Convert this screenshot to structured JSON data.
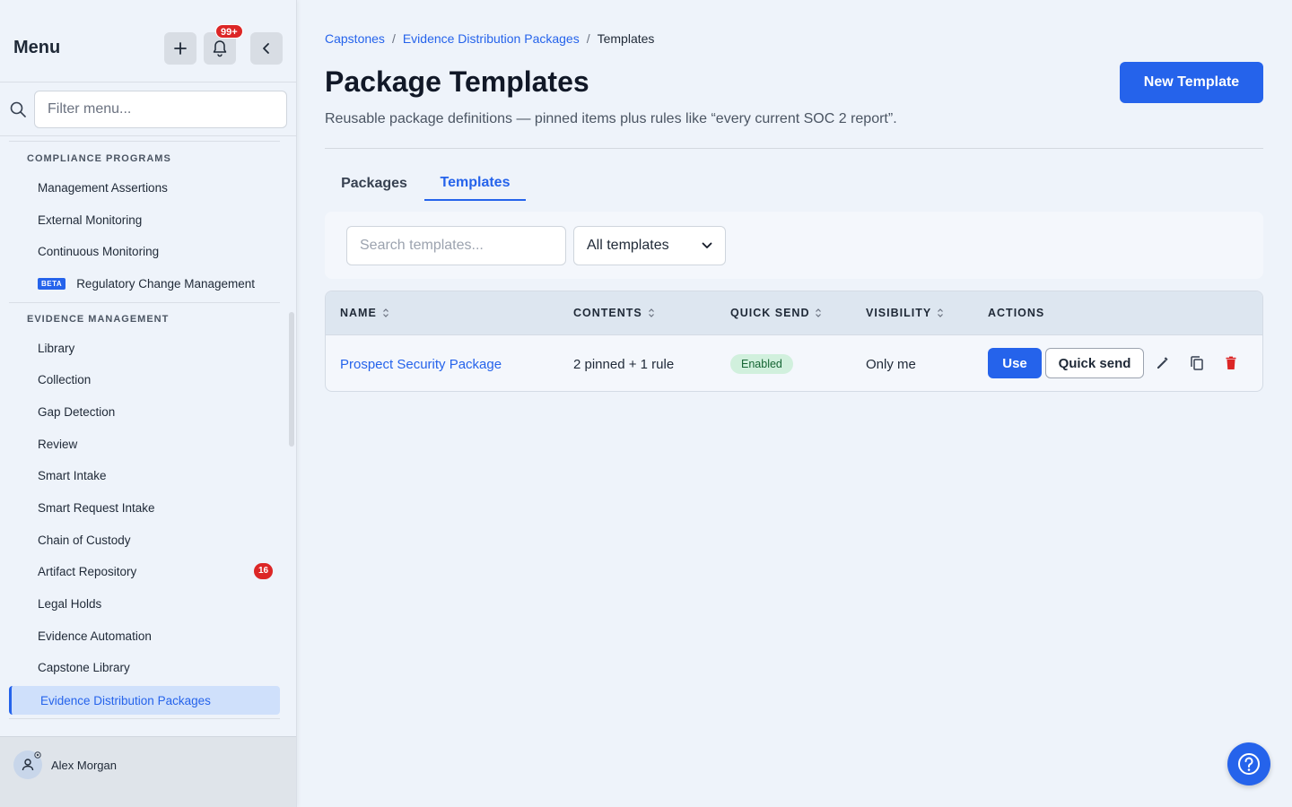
{
  "sidebar": {
    "title": "Menu",
    "bell_badge": "99+",
    "filter_placeholder": "Filter menu...",
    "sections": [
      {
        "heading": "COMPLIANCE PROGRAMS",
        "items": [
          {
            "label": "Management Assertions"
          },
          {
            "label": "External Monitoring"
          },
          {
            "label": "Continuous Monitoring"
          },
          {
            "label": "Regulatory Change Management",
            "badge": "BETA"
          }
        ]
      },
      {
        "heading": "EVIDENCE MANAGEMENT",
        "items": [
          {
            "label": "Library"
          },
          {
            "label": "Collection"
          },
          {
            "label": "Gap Detection"
          },
          {
            "label": "Review"
          },
          {
            "label": "Smart Intake"
          },
          {
            "label": "Smart Request Intake"
          },
          {
            "label": "Chain of Custody"
          },
          {
            "label": "Artifact Repository",
            "count": "16"
          },
          {
            "label": "Legal Holds"
          },
          {
            "label": "Evidence Automation"
          },
          {
            "label": "Capstone Library"
          },
          {
            "label": "Evidence Distribution Packages",
            "active": true
          }
        ]
      }
    ],
    "user": {
      "name": "Alex Morgan"
    }
  },
  "breadcrumb": {
    "items": [
      "Capstones",
      "Evidence Distribution Packages"
    ],
    "separator": "/",
    "current": "Templates"
  },
  "page": {
    "title": "Package Templates",
    "subtitle": "Reusable package definitions — pinned items plus rules like “every current SOC 2 report”.",
    "new_button": "New Template"
  },
  "tabs": [
    {
      "label": "Packages",
      "active": false
    },
    {
      "label": "Templates",
      "active": true
    }
  ],
  "filters": {
    "search_placeholder": "Search templates...",
    "select_value": "All templates"
  },
  "table": {
    "columns": [
      "NAME",
      "CONTENTS",
      "QUICK SEND",
      "VISIBILITY",
      "ACTIONS"
    ],
    "rows": [
      {
        "name": "Prospect Security Package",
        "contents": "2 pinned + 1 rule",
        "quick_send": "Enabled",
        "visibility": "Only me",
        "use_label": "Use",
        "quick_send_label": "Quick send"
      }
    ]
  },
  "colors": {
    "accent": "#2563eb",
    "danger": "#dc2626",
    "success_bg": "#d1f0dd",
    "success_text": "#166534"
  }
}
